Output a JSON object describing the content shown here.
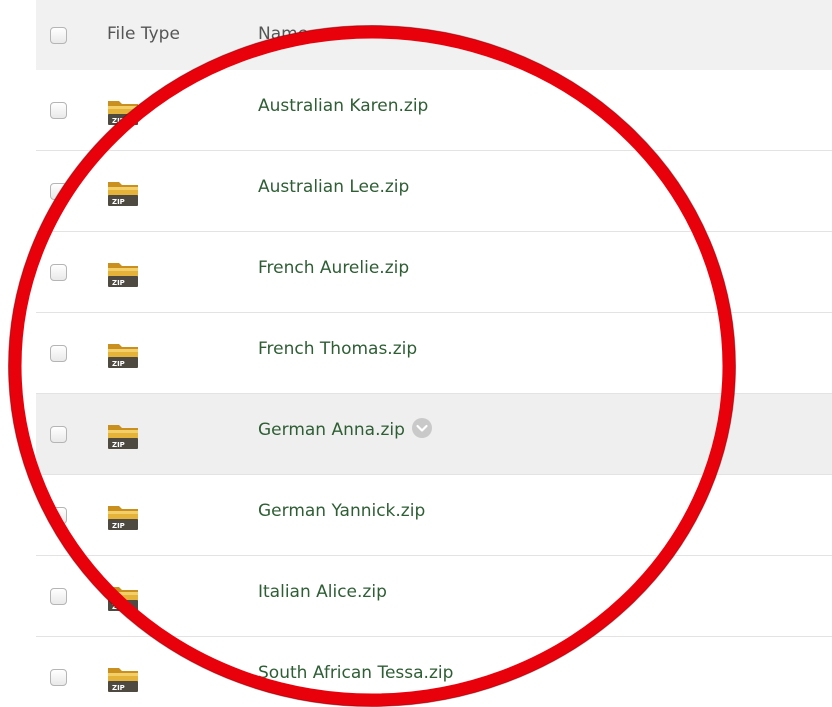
{
  "table": {
    "header": {
      "file_type_label": "File Type",
      "name_label": "Name"
    },
    "rows": [
      {
        "name": "Australian Karen.zip",
        "icon": "zip-folder-icon"
      },
      {
        "name": "Australian Lee.zip",
        "icon": "zip-folder-icon"
      },
      {
        "name": "French Aurelie.zip",
        "icon": "zip-folder-icon"
      },
      {
        "name": "French Thomas.zip",
        "icon": "zip-folder-icon"
      },
      {
        "name": "German Anna.zip",
        "icon": "zip-folder-icon",
        "hovered": true
      },
      {
        "name": "German Yannick.zip",
        "icon": "zip-folder-icon"
      },
      {
        "name": "Italian Alice.zip",
        "icon": "zip-folder-icon"
      },
      {
        "name": "South African Tessa.zip",
        "icon": "zip-folder-icon"
      }
    ],
    "zip_badge_text": "ZIP"
  },
  "colors": {
    "link_text": "#2e5e34",
    "header_bg": "#f1f1f1",
    "hover_row_bg": "#efefef",
    "annotation_circle": "#e8000b",
    "folder_yellow": "#e5b23a"
  }
}
